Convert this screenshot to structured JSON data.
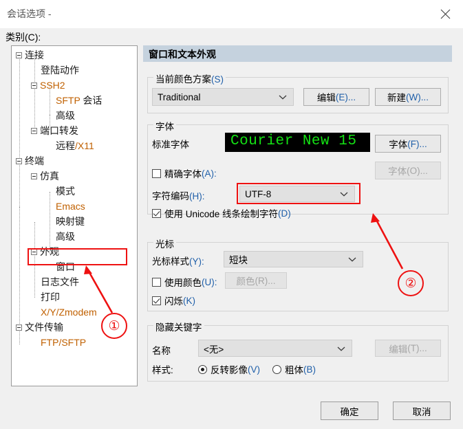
{
  "window": {
    "title": "会话选项 -",
    "close_icon": "close-icon"
  },
  "sidebar": {
    "label": "类别(C):",
    "label_main": "类别",
    "label_mn": "(C):",
    "items": [
      {
        "text": "连接",
        "level": 0,
        "expander": true
      },
      {
        "text": "登陆动作",
        "level": 1,
        "expander": false
      },
      {
        "text": "SSH2",
        "level": 1,
        "expander": true,
        "latin": true
      },
      {
        "text": "SFTP 会话",
        "level": 2,
        "expander": false,
        "mixed": true
      },
      {
        "text": "高级",
        "level": 2,
        "expander": false
      },
      {
        "text": "端口转发",
        "level": 1,
        "expander": true
      },
      {
        "text": "远程/X11",
        "level": 2,
        "expander": false,
        "mixed": true
      },
      {
        "text": "终端",
        "level": 0,
        "expander": true
      },
      {
        "text": "仿真",
        "level": 1,
        "expander": true
      },
      {
        "text": "模式",
        "level": 2,
        "expander": false
      },
      {
        "text": "Emacs",
        "level": 2,
        "expander": false,
        "latin": true
      },
      {
        "text": "映射键",
        "level": 2,
        "expander": false
      },
      {
        "text": "高级",
        "level": 2,
        "expander": false
      },
      {
        "text": "外观",
        "level": 1,
        "expander": true,
        "selected": true
      },
      {
        "text": "窗口",
        "level": 2,
        "expander": false
      },
      {
        "text": "日志文件",
        "level": 1,
        "expander": false
      },
      {
        "text": "打印",
        "level": 1,
        "expander": false
      },
      {
        "text": "X/Y/Zmodem",
        "level": 1,
        "expander": false,
        "latin": true
      },
      {
        "text": "文件传输",
        "level": 0,
        "expander": true
      },
      {
        "text": "FTP/SFTP",
        "level": 1,
        "expander": false,
        "latin": true
      }
    ]
  },
  "panel": {
    "header": "窗口和文本外观",
    "color_scheme": {
      "group_title": "当前颜色方案",
      "group_title_mn": "(S)",
      "value": "Traditional",
      "edit_button": "编辑",
      "edit_button_mn": "(E)...",
      "new_button": "新建",
      "new_button_mn": "(W)..."
    },
    "font": {
      "group_title": "字体",
      "normal_font_label": "标准字体",
      "preview_text": "Courier New 15",
      "preview_fg": "#14e214",
      "preview_bg": "#000000",
      "font_button": "字体",
      "font_button_mn": "(F)...",
      "exact_font_label": "精确字体",
      "exact_font_mn": "(A):",
      "exact_font_checked": false,
      "exact_font_button": "字体",
      "exact_font_button_mn": "(O)...",
      "exact_font_button_disabled": true,
      "charset_label": "字符编码",
      "charset_mn": "(H):",
      "charset_value": "UTF-8",
      "unicode_label": "使用 Unicode 线条绘制字符",
      "unicode_mn": "(D)",
      "unicode_checked": true
    },
    "cursor": {
      "group_title": "光标",
      "style_label": "光标样式",
      "style_mn": "(Y):",
      "style_value": "短块",
      "use_color_label": "使用颜色",
      "use_color_mn": "(U):",
      "use_color_checked": false,
      "color_button": "颜色",
      "color_button_mn": "(R)...",
      "color_button_disabled": true,
      "blink_label": "闪烁",
      "blink_mn": "(K)",
      "blink_checked": true
    },
    "keyword": {
      "group_title": "隐藏关键字",
      "name_label": "名称",
      "name_value": "<无>",
      "edit_button": "编辑",
      "edit_button_mn": "(T)...",
      "edit_button_disabled": true,
      "style_label": "样式:",
      "option_reverse": "反转影像",
      "option_reverse_mn": "(V)",
      "option_reverse_selected": true,
      "option_bold": "粗体",
      "option_bold_mn": "(B)",
      "option_bold_selected": false
    }
  },
  "footer": {
    "ok_label": "确定",
    "cancel_label": "取消"
  },
  "annotations": {
    "color": "#ee1111",
    "marker_one": "①",
    "marker_two": "②"
  }
}
